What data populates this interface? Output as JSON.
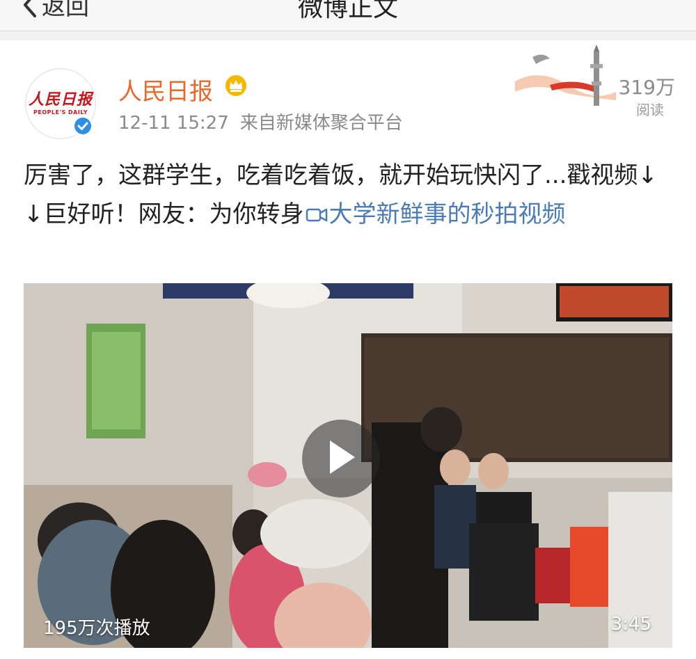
{
  "nav": {
    "back_label": "返回",
    "title": "微博正文"
  },
  "post": {
    "author": "人民日报",
    "avatar_logo": "人民日报",
    "avatar_sub": "PEOPLE'S DAILY",
    "time": "12-11 15:27",
    "source": "来自新媒体聚合平台",
    "read_count": "319万",
    "read_label": "阅读",
    "text": "厉害了，这群学生，吃着吃着饭，就开始玩快闪了...戳视频↓↓巨好听！网友：为你转身",
    "link_text": "大学新鲜事的秒拍视频"
  },
  "video": {
    "play_count": "195万次播放",
    "duration": "3:45"
  },
  "colors": {
    "name": "#e8692a",
    "link": "#4a7bb5",
    "brand_red": "#c8161d",
    "verified": "#2f8fe0"
  },
  "icons": {
    "back": "chevron-left-icon",
    "vip": "crown-badge-icon",
    "verified": "verified-check-icon",
    "video_link": "video-camera-icon",
    "play": "play-icon"
  }
}
